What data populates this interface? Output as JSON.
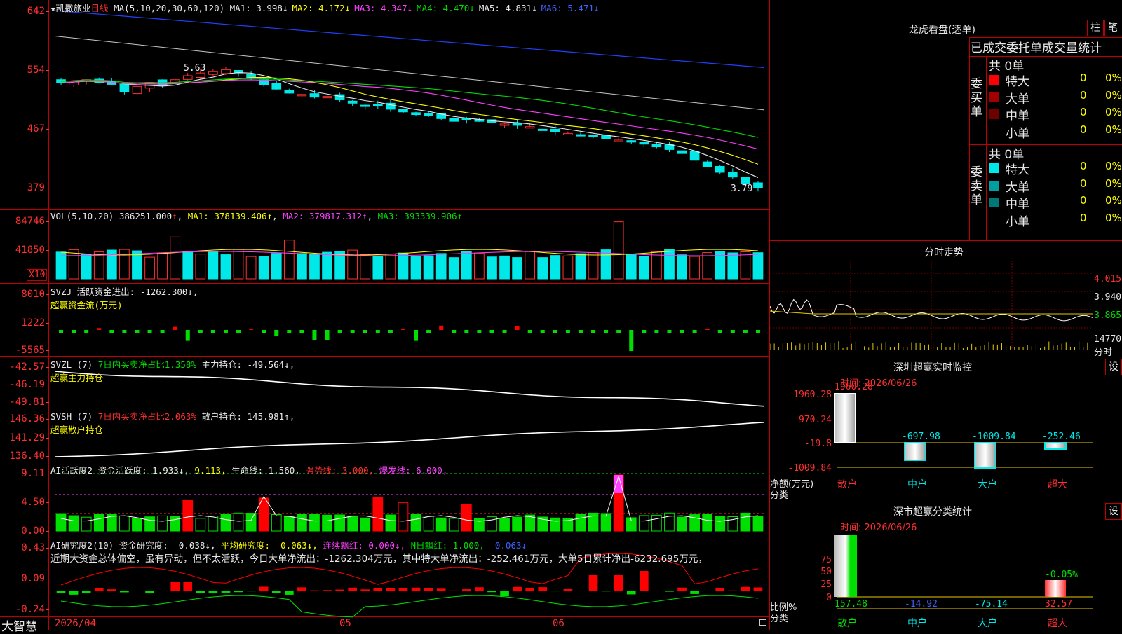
{
  "stock": {
    "name": "★凯撒旅业",
    "period": "日线"
  },
  "main_panel": {
    "ma_label": "MA(5,10,20,30,60,120)",
    "ma_items": [
      {
        "name": "MA1",
        "value": "3.998",
        "arrow": "↓",
        "color": "#e8e8e8"
      },
      {
        "name": "MA2",
        "value": "4.172",
        "arrow": "↓",
        "color": "#ffff00"
      },
      {
        "name": "MA3",
        "value": "4.347",
        "arrow": "↓",
        "color": "#ff40ff"
      },
      {
        "name": "MA4",
        "value": "4.470",
        "arrow": "↓",
        "color": "#00e000"
      },
      {
        "name": "MA5",
        "value": "4.831",
        "arrow": "↓",
        "color": "#e8e8e8"
      },
      {
        "name": "MA6",
        "value": "5.471",
        "arrow": "↓",
        "color": "#4060ff"
      }
    ],
    "y_ticks": [
      "642",
      "554",
      "467",
      "379"
    ],
    "high_label": "5.63",
    "low_label": "3.79"
  },
  "vol_panel": {
    "label": "VOL(5,10,20)",
    "value": "386251.000",
    "arrow": "↑",
    "ma1": "MA1: 378139.406↑",
    "ma2": "MA2: 379817.312↑",
    "ma3": "MA3: 393339.906↑",
    "y_ticks": [
      "84746",
      "41850"
    ],
    "unit": "X10"
  },
  "svzj_panel": {
    "label": "SVZJ",
    "desc": "活跃资金进出: -1262.300↓,",
    "subtitle": "超赢资金流(万元)",
    "y_ticks": [
      "8010",
      "1222",
      "-5565"
    ]
  },
  "svzl_panel": {
    "label": "SVZL (7)",
    "ratio": "7日内买卖净占比1.358%",
    "hold": "主力持仓: -49.564↓,",
    "subtitle": "超赢主力持仓",
    "y_ticks": [
      "-42.57",
      "-46.19",
      "-49.81"
    ]
  },
  "svsh_panel": {
    "label": "SVSH (7)",
    "ratio": "7日内买卖净占比2.063%",
    "hold": "散户持仓: 145.981↑,",
    "subtitle": "超赢散户持仓",
    "y_ticks": [
      "146.36",
      "141.29",
      "136.40"
    ]
  },
  "ai_active": {
    "label": "AI活跃度2",
    "items": [
      "资金活跃度: 1.933↓",
      "9.113,",
      "生命线: 1.560,",
      "强势线: 3.000,",
      "爆发线: 6.000,"
    ],
    "y_ticks": [
      "9.11",
      "4.50",
      "0.00"
    ]
  },
  "ai_research": {
    "label": "AI研究度2(10)",
    "items": [
      "资金研究度: -0.038↓,",
      "平均研究度: -0.063↓,",
      "连续飘红: 0.000↓,",
      "N日飘红: 1.000,",
      "-0.063↓"
    ],
    "comment": "近期大资金总体偏空，虽有异动，但不太活跃，今日大单净流出：-1262.304万元，其中特大单净流出：-252.461万元，大单5日累计净出-6232.695万元，",
    "y_ticks": [
      "0.43",
      "0.09",
      "-0.24"
    ]
  },
  "x_axis": {
    "labels": [
      "2026/04",
      "05",
      "06"
    ]
  },
  "footer": {
    "brand": "大智慧"
  },
  "right": {
    "dragon_title": "龙虎看盘(逐单)",
    "tab_zhu": "柱",
    "tab_bi": "笔",
    "table_title": "已成交委托单成交量统计",
    "buy": {
      "side": "委买单",
      "total": "共 0单",
      "rows": [
        {
          "label": "特大",
          "count": "0",
          "pct": "0%",
          "color": "#ff0000"
        },
        {
          "label": "大单",
          "count": "0",
          "pct": "0%",
          "color": "#a00000"
        },
        {
          "label": "中单",
          "count": "0",
          "pct": "0%",
          "color": "#700000"
        },
        {
          "label": "小单",
          "count": "0",
          "pct": "0%",
          "color": ""
        }
      ]
    },
    "sell": {
      "side": "委卖单",
      "total": "共 0单",
      "rows": [
        {
          "label": "特大",
          "count": "0",
          "pct": "0%",
          "color": "#00e8e8"
        },
        {
          "label": "大单",
          "count": "0",
          "pct": "0%",
          "color": "#00a0a0"
        },
        {
          "label": "中单",
          "count": "0",
          "pct": "0%",
          "color": "#007878"
        },
        {
          "label": "小单",
          "count": "0",
          "pct": "0%",
          "color": ""
        }
      ]
    },
    "intraday": {
      "title": "分时走势",
      "ticks": [
        "4.015",
        "3.940",
        "3.865"
      ],
      "vol": "14770",
      "vol_label": "分时"
    },
    "monitor": {
      "title": "深圳超赢实时监控",
      "setting": "设",
      "time": "时间: 2026/06/26",
      "y_ticks": [
        "1960.28",
        "970.24",
        "-19.8",
        "-1009.84"
      ],
      "values": [
        "1960.28",
        "-697.98",
        "-1009.84",
        "-252.46"
      ],
      "categories": [
        "散户",
        "中户",
        "大户",
        "超大"
      ],
      "unit": "净额(万元)",
      "class_label": "分类"
    },
    "stats": {
      "title": "深市超赢分类统计",
      "setting": "设",
      "time": "时间: 2026/06/26",
      "y_ticks": [
        "75",
        "50",
        "25",
        "0"
      ],
      "values": [
        "157.48",
        "-14.92",
        "-75.14",
        "32.57"
      ],
      "top_label": "-0.05%",
      "categories": [
        "散户",
        "中户",
        "大户",
        "超大"
      ],
      "unit": "比例%",
      "class_label": "分类"
    }
  },
  "chart_data": [
    {
      "type": "candlestick",
      "title": "凯撒旅业 日线",
      "ma_lines": [
        "MA1",
        "MA2",
        "MA3",
        "MA4",
        "MA5",
        "MA6"
      ],
      "ylim": [
        379,
        642
      ],
      "high": 5.63,
      "low": 3.79,
      "closes": [
        5.35,
        5.38,
        5.4,
        5.36,
        5.33,
        5.22,
        5.3,
        5.36,
        5.31,
        5.4,
        5.46,
        5.5,
        5.52,
        5.55,
        5.5,
        5.42,
        5.32,
        5.26,
        5.2,
        5.18,
        5.14,
        5.15,
        5.1,
        5.05,
        5.0,
        5.02,
        4.96,
        4.92,
        4.88,
        4.86,
        4.82,
        4.78,
        4.8,
        4.78,
        4.76,
        4.74,
        4.72,
        4.7,
        4.66,
        4.62,
        4.6,
        4.58,
        4.55,
        4.52,
        4.5,
        4.47,
        4.44,
        4.4,
        4.36,
        4.3,
        4.2,
        4.1,
        4.02,
        3.95,
        3.85,
        3.79
      ]
    },
    {
      "type": "bar",
      "title": "VOL",
      "ylim": [
        0,
        84746
      ]
    },
    {
      "type": "bar",
      "title": "SVZJ",
      "ylim": [
        -5565,
        8010
      ]
    },
    {
      "type": "line",
      "title": "SVZL",
      "ylim": [
        -49.81,
        -42.57
      ]
    },
    {
      "type": "line",
      "title": "SVSH",
      "ylim": [
        136.4,
        146.36
      ]
    },
    {
      "type": "bar",
      "title": "AI活跃度2",
      "ylim": [
        0,
        9.11
      ]
    },
    {
      "type": "bar",
      "title": "AI研究度2",
      "ylim": [
        -0.24,
        0.43
      ]
    },
    {
      "type": "bar",
      "title": "深圳超赢实时监控",
      "categories": [
        "散户",
        "中户",
        "大户",
        "超大"
      ],
      "values": [
        1960.28,
        -697.98,
        -1009.84,
        -252.46
      ]
    },
    {
      "type": "bar",
      "title": "深市超赢分类统计",
      "categories": [
        "散户",
        "中户",
        "大户",
        "超大"
      ],
      "values": [
        157.48,
        -14.92,
        -75.14,
        32.57
      ]
    }
  ]
}
